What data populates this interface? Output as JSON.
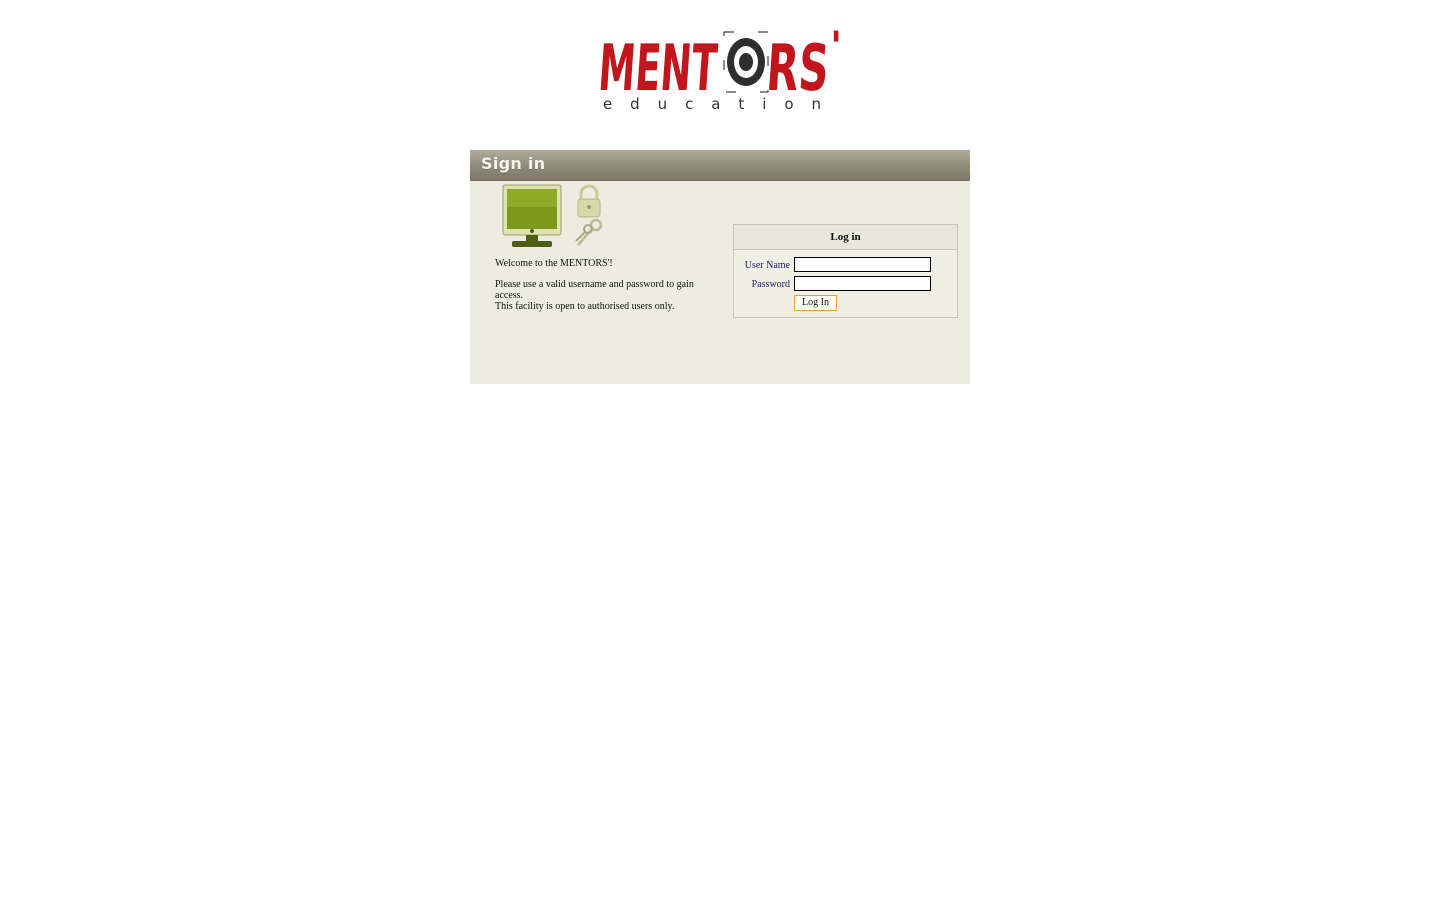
{
  "brand": {
    "name": "MENTORS'",
    "tagline": "education",
    "logo_color": "#c0161c",
    "ring_color": "#3a3a3a"
  },
  "panel": {
    "title": "Sign in",
    "header_color": "#8f8a79",
    "background_color": "#ecede0"
  },
  "hero": {
    "icons": [
      "monitor-icon",
      "padlock-icon",
      "keys-icon"
    ]
  },
  "welcome": {
    "line1": "Welcome to the MENTORS'!",
    "line2": "Please use a valid username and password to gain access.",
    "line3": "This facility is open to authorised users only."
  },
  "login": {
    "title": "Log in",
    "username_label": "User Name",
    "username_value": "",
    "password_label": "Password",
    "password_value": "",
    "submit_label": "Log In"
  }
}
